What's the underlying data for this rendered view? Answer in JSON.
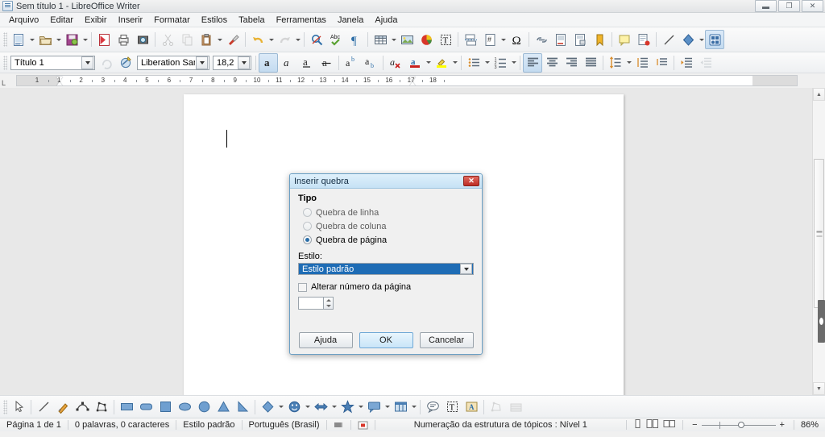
{
  "window": {
    "title": "Sem título 1 - LibreOffice Writer",
    "app_icon": "writer-document-icon",
    "controls": {
      "minimize": "minimize-icon",
      "restore": "restore-icon",
      "close": "close-icon"
    }
  },
  "menubar": {
    "items": [
      {
        "label": "Arquivo",
        "accel": "A"
      },
      {
        "label": "Editar",
        "accel": "E"
      },
      {
        "label": "Exibir",
        "accel": "x"
      },
      {
        "label": "Inserir",
        "accel": "I"
      },
      {
        "label": "Formatar",
        "accel": "F"
      },
      {
        "label": "Estilos",
        "accel": "s"
      },
      {
        "label": "Tabela",
        "accel": "T"
      },
      {
        "label": "Ferramentas",
        "accel": "r"
      },
      {
        "label": "Janela",
        "accel": "J"
      },
      {
        "label": "Ajuda",
        "accel": "u"
      }
    ]
  },
  "main_toolbar": {
    "buttons": [
      {
        "name": "new-doc-icon",
        "tip": "Novo",
        "split": true
      },
      {
        "name": "open-folder-icon",
        "tip": "Abrir",
        "split": true
      },
      {
        "name": "save-icon",
        "tip": "Salvar",
        "split": true
      },
      {
        "name": "export-pdf-icon",
        "tip": "Exportar como PDF"
      },
      {
        "name": "print-icon",
        "tip": "Imprimir"
      },
      {
        "name": "print-preview-icon",
        "tip": "Visualizar impressão"
      },
      {
        "name": "cut-icon",
        "tip": "Cortar",
        "disabled": true
      },
      {
        "name": "copy-icon",
        "tip": "Copiar",
        "disabled": true
      },
      {
        "name": "paste-icon",
        "tip": "Colar",
        "split": true
      },
      {
        "name": "clone-formatting-icon",
        "tip": "Clonar formatação"
      },
      {
        "name": "undo-icon",
        "tip": "Desfazer",
        "split": true
      },
      {
        "name": "redo-icon",
        "tip": "Refazer",
        "split": true,
        "disabled": true
      },
      {
        "name": "find-replace-icon",
        "tip": "Localizar e substituir"
      },
      {
        "name": "spelling-icon",
        "tip": "Ortografia"
      },
      {
        "name": "formatting-marks-icon",
        "tip": "Marcas de formatação"
      },
      {
        "name": "insert-table-icon",
        "tip": "Inserir tabela",
        "split": true
      },
      {
        "name": "insert-image-icon",
        "tip": "Inserir imagem"
      },
      {
        "name": "insert-chart-icon",
        "tip": "Inserir gráfico"
      },
      {
        "name": "text-box-icon",
        "tip": "Caixa de texto"
      },
      {
        "name": "page-break-icon",
        "tip": "Inserir quebra de página"
      },
      {
        "name": "insert-field-icon",
        "tip": "Inserir campo",
        "split": true
      },
      {
        "name": "special-character-icon",
        "tip": "Caractere especial"
      },
      {
        "name": "hyperlink-icon",
        "tip": "Hiperlink"
      },
      {
        "name": "footnote-icon",
        "tip": "Nota de rodapé"
      },
      {
        "name": "endnote-icon",
        "tip": "Nota de fim"
      },
      {
        "name": "bookmark-icon",
        "tip": "Marcador"
      },
      {
        "name": "cross-reference-icon",
        "tip": "Referência"
      },
      {
        "name": "comment-icon",
        "tip": "Comentário"
      },
      {
        "name": "track-changes-icon",
        "tip": "Registrar alterações"
      },
      {
        "name": "line-icon",
        "tip": "Inserir linha"
      },
      {
        "name": "basic-shapes-icon",
        "tip": "Formas básicas",
        "split": true
      },
      {
        "name": "show-draw-functions-icon",
        "tip": "Mostrar funções de desenho",
        "active": true
      }
    ]
  },
  "format_toolbar": {
    "paragraph_style": "Título 1",
    "font_name": "Liberation Sans",
    "font_size": "18,2",
    "update_style_icon": "update-style-icon",
    "new-style-icon": "new-style-icon",
    "buttons": [
      {
        "name": "bold-icon",
        "label": "a",
        "active": true
      },
      {
        "name": "italic-icon",
        "label": "a"
      },
      {
        "name": "underline-icon",
        "label": "a"
      },
      {
        "name": "strikethrough-icon",
        "label": "a"
      },
      {
        "name": "superscript-icon",
        "label": "ab"
      },
      {
        "name": "subscript-icon",
        "label": "ab"
      },
      {
        "name": "clear-formatting-icon",
        "label": "a"
      },
      {
        "name": "font-color-icon",
        "label": "A",
        "color": "#c9211e",
        "split": true
      },
      {
        "name": "highlight-color-icon",
        "label": "A",
        "color": "#ffff00",
        "split": true
      },
      {
        "name": "unordered-list-icon",
        "split": true
      },
      {
        "name": "ordered-list-icon",
        "split": true
      },
      {
        "name": "align-left-icon",
        "active": true
      },
      {
        "name": "align-center-icon"
      },
      {
        "name": "align-right-icon"
      },
      {
        "name": "justified-icon"
      },
      {
        "name": "line-spacing-icon",
        "split": true
      },
      {
        "name": "increase-paragraph-spacing-icon"
      },
      {
        "name": "decrease-paragraph-spacing-icon"
      },
      {
        "name": "increase-indent-icon"
      },
      {
        "name": "decrease-indent-icon",
        "disabled": true
      }
    ]
  },
  "ruler": {
    "corner_glyph": "L",
    "unit_marks": [
      "1",
      "1",
      "2",
      "3",
      "4",
      "5",
      "6",
      "7",
      "8",
      "9",
      "10",
      "11",
      "12",
      "13",
      "14",
      "15",
      "16",
      "17",
      "18"
    ]
  },
  "draw_toolbar": {
    "buttons": [
      {
        "name": "select-cursor-icon"
      },
      {
        "name": "line-tool-icon"
      },
      {
        "name": "freeform-line-icon"
      },
      {
        "name": "curve-icon"
      },
      {
        "name": "polygon-icon"
      },
      {
        "name": "rectangle-icon"
      },
      {
        "name": "rounded-rectangle-icon"
      },
      {
        "name": "square-icon"
      },
      {
        "name": "ellipse-icon"
      },
      {
        "name": "circle-icon"
      },
      {
        "name": "triangle-icon"
      },
      {
        "name": "right-triangle-icon"
      },
      {
        "name": "diamond-icon",
        "split": true
      },
      {
        "name": "symbol-shapes-icon",
        "split": true
      },
      {
        "name": "block-arrows-icon",
        "split": true
      },
      {
        "name": "stars-icon",
        "split": true
      },
      {
        "name": "callout-shapes-icon",
        "split": true
      },
      {
        "name": "flowchart-shapes-icon",
        "split": true
      },
      {
        "name": "callout-icon"
      },
      {
        "name": "insert-text-box-icon"
      },
      {
        "name": "fontwork-icon"
      },
      {
        "name": "edit-points-icon",
        "disabled": true
      },
      {
        "name": "gallery-icon",
        "disabled": true
      }
    ]
  },
  "statusbar": {
    "page": "Página 1 de 1",
    "word_count": "0 palavras, 0 caracteres",
    "page_style": "Estilo padrão",
    "language": "Português (Brasil)",
    "selection_mode_icon": "selection-mode-icon",
    "save_state_icon": "unsaved-changes-icon",
    "outline": "Numeração da estrutura de tópicos : Nível 1",
    "view_layout": [
      "single-page-view-icon",
      "multi-page-view-icon",
      "book-view-icon"
    ],
    "zoom_out": "−",
    "zoom_in": "+",
    "zoom_level": "86%"
  },
  "dialog": {
    "title": "Inserir quebra",
    "close_icon": "dialog-close-icon",
    "group_label": "Tipo",
    "options": [
      {
        "label": "Quebra de  linha",
        "accel": "l",
        "checked": false
      },
      {
        "label": "Quebra de coluna",
        "accel": "d",
        "checked": false
      },
      {
        "label": "Quebra de página",
        "accel": "p",
        "checked": true
      }
    ],
    "style_label": "Estilo:",
    "style_value": "Estilo padrão",
    "change_page_number_label": "Alterar número da página",
    "change_page_number_checked": false,
    "page_number_value": "",
    "buttons": {
      "help": "Ajuda",
      "ok": "OK",
      "cancel": "Cancelar"
    }
  },
  "colors": {
    "dialog_border": "#6a9fc4",
    "selection_blue": "#1e6cb5",
    "close_red": "#bc2d25",
    "accent": "#2a6ea8"
  }
}
